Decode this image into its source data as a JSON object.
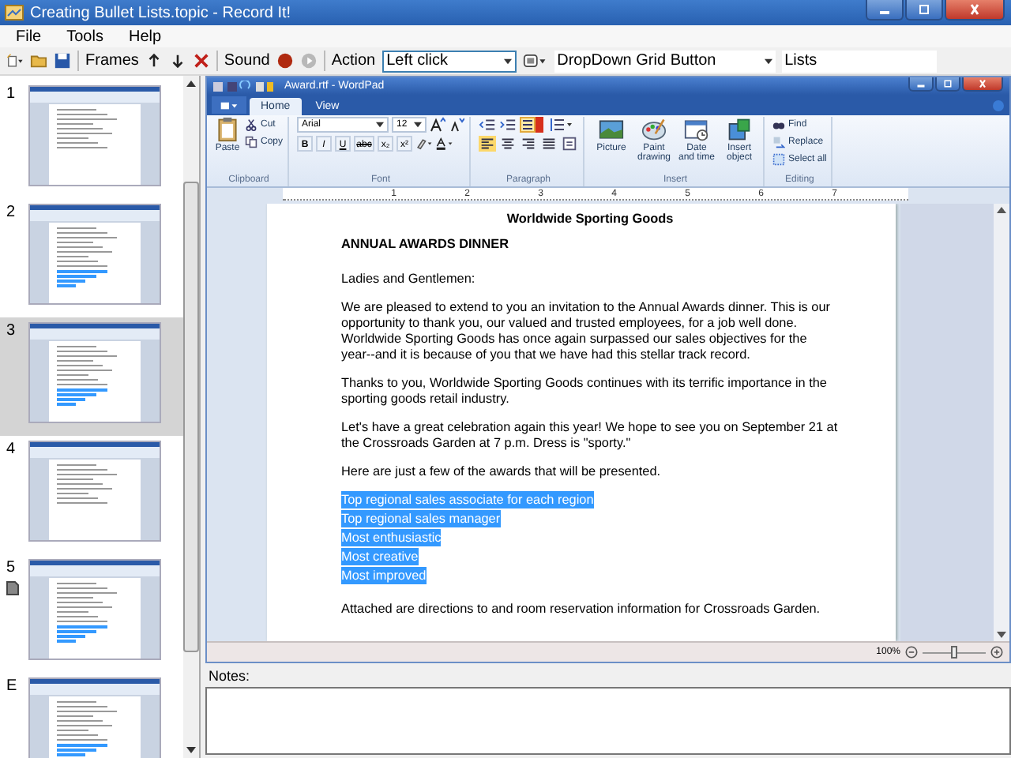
{
  "window": {
    "title": "Creating Bullet Lists.topic - Record It!"
  },
  "menu": [
    "File",
    "Tools",
    "Help"
  ],
  "toolbar": {
    "frames_label": "Frames",
    "sound_label": "Sound",
    "action_label": "Action",
    "action_value": "Left click",
    "control_type": "DropDown Grid Button",
    "control_name": "Lists"
  },
  "frames": [
    {
      "label": "1",
      "selected": false,
      "has_note": false,
      "highlight": false
    },
    {
      "label": "2",
      "selected": false,
      "has_note": false,
      "highlight": true
    },
    {
      "label": "3",
      "selected": true,
      "has_note": false,
      "highlight": true
    },
    {
      "label": "4",
      "selected": false,
      "has_note": false,
      "highlight": false
    },
    {
      "label": "5",
      "selected": false,
      "has_note": true,
      "highlight": true
    },
    {
      "label": "E",
      "selected": false,
      "has_note": false,
      "highlight": true
    }
  ],
  "wordpad": {
    "title": "Award.rtf - WordPad",
    "tabs": [
      {
        "label": "Home",
        "selected": true
      },
      {
        "label": "View",
        "selected": false
      }
    ],
    "ribbon": {
      "paste": "Paste",
      "cut": "Cut",
      "copy": "Copy",
      "font_name": "Arial",
      "font_size": "12",
      "format_buttons": [
        "B",
        "I",
        "U",
        "abc",
        "x₂",
        "x²"
      ],
      "insert_buttons": [
        "Picture",
        "Paint drawing",
        "Date and time",
        "Insert object"
      ],
      "editing_buttons": [
        "Find",
        "Replace",
        "Select all"
      ],
      "groups": [
        "Clipboard",
        "Font",
        "Paragraph",
        "Insert",
        "Editing"
      ]
    },
    "ruler_numbers": [
      "1",
      "2",
      "3",
      "4",
      "5",
      "6",
      "7"
    ],
    "document": {
      "heading": "Worldwide Sporting Goods",
      "subheading": "ANNUAL AWARDS DINNER",
      "paragraphs": [
        "Ladies and Gentlemen:",
        "We are pleased to extend to you an invitation to the Annual Awards dinner.  This is our opportunity to thank you, our valued and trusted employees, for a job well done.  Worldwide Sporting Goods has once again surpassed our sales objectives for the year--and it is because of you that we have had this stellar track record.",
        "Thanks to you, Worldwide Sporting Goods continues with its terrific importance in the sporting goods retail industry.",
        "Let's have a great celebration again this year!  We hope to see you on September 21 at the Crossroads Garden at 7 p.m. Dress is \"sporty.\"",
        "Here are just a few of the awards that will be presented."
      ],
      "awards": [
        {
          "text": "Top regional sales associate for each region",
          "selected": true
        },
        {
          "text": "Top regional sales manager",
          "selected": true
        },
        {
          "text": "Most enthusiastic",
          "selected": true
        },
        {
          "text": "Most creative",
          "selected": true
        },
        {
          "text": "Most improved",
          "selected": true
        }
      ],
      "closing": "Attached are directions to and room reservation information for Crossroads Garden."
    },
    "zoom": {
      "reading": "100%",
      "level": 0.5
    }
  },
  "notes": {
    "label": "Notes:"
  }
}
